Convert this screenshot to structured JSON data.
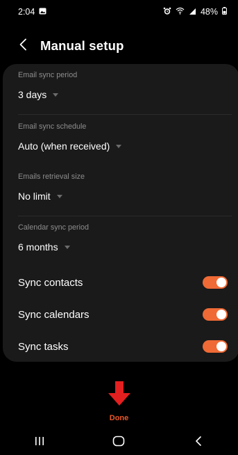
{
  "status_bar": {
    "time": "2:04",
    "battery": "48%"
  },
  "header": {
    "title": "Manual setup"
  },
  "settings": [
    {
      "label": "Email sync period",
      "value": "3 days"
    },
    {
      "label": "Email sync schedule",
      "value": "Auto (when received)"
    },
    {
      "label": "Emails retrieval size",
      "value": "No limit"
    },
    {
      "label": "Calendar sync period",
      "value": "6 months"
    }
  ],
  "toggles": [
    {
      "label": "Sync contacts",
      "on": true
    },
    {
      "label": "Sync calendars",
      "on": true
    },
    {
      "label": "Sync tasks",
      "on": true
    }
  ],
  "footer": {
    "done_label": "Done"
  },
  "colors": {
    "accent": "#ef6a35",
    "done_text": "#e8572a",
    "arrow": "#e31f1f",
    "card": "#1a1a1a"
  }
}
